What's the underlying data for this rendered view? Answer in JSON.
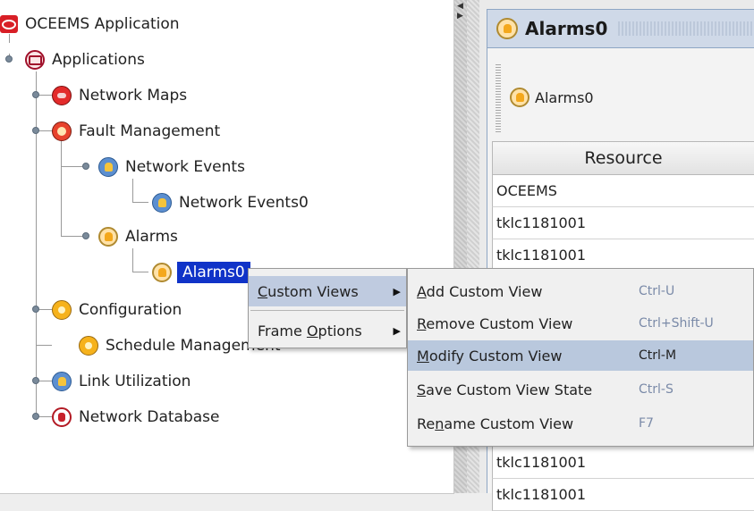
{
  "tree": {
    "root": "OCEEMS Application",
    "applications": "Applications",
    "network_maps": "Network Maps",
    "fault_management": "Fault Management",
    "network_events": "Network Events",
    "network_events0": "Network Events0",
    "alarms": "Alarms",
    "alarms0_selected": "Alarms0",
    "configuration": "Configuration",
    "schedule_management": "Schedule Management",
    "link_utilization": "Link Utilization",
    "network_database": "Network Database"
  },
  "frame": {
    "title": "Alarms0",
    "toolbar_button": "Alarms0",
    "table_header": "Resource",
    "rows": [
      "OCEEMS",
      "tklc1181001",
      "tklc1181001",
      "tklc1181001",
      "tklc1181001"
    ]
  },
  "context_menu": {
    "custom_views": {
      "pre": "",
      "mnemonic": "C",
      "post": "ustom Views"
    },
    "frame_options": {
      "pre": "Frame ",
      "mnemonic": "O",
      "post": "ptions"
    }
  },
  "submenu": [
    {
      "pre": "",
      "mnemonic": "A",
      "post": "dd Custom View",
      "shortcut": "Ctrl-U",
      "active": false
    },
    {
      "pre": "",
      "mnemonic": "R",
      "post": "emove Custom View",
      "shortcut": "Ctrl+Shift-U",
      "active": false
    },
    {
      "pre": "",
      "mnemonic": "M",
      "post": "odify Custom View",
      "shortcut": "Ctrl-M",
      "active": true
    },
    {
      "pre": "",
      "mnemonic": "S",
      "post": "ave Custom View State",
      "shortcut": "Ctrl-S",
      "active": false
    },
    {
      "pre": "Re",
      "mnemonic": "n",
      "post": "ame Custom View",
      "shortcut": "F7",
      "active": false
    }
  ],
  "colors": {
    "selection": "#1033c8",
    "menu_highlight": "#b9c8dd",
    "shortcut_text": "#7a8aa8"
  }
}
